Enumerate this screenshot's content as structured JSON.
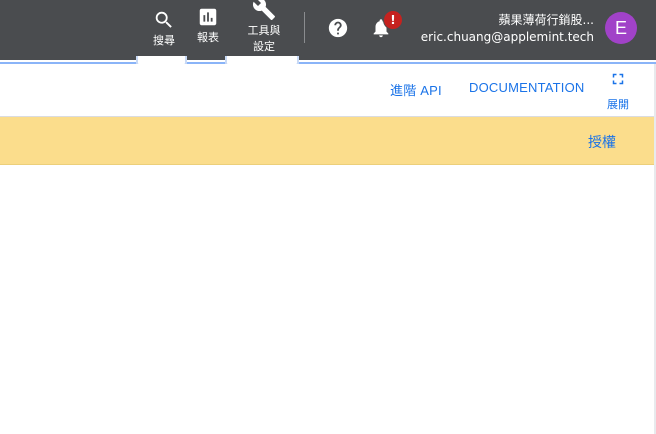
{
  "topbar": {
    "search_label": "搜尋",
    "reports_label": "報表",
    "tools_label_line1": "工具與",
    "tools_label_line2": "設定",
    "notification_badge": "!",
    "account_name": "蘋果薄荷行銷股...",
    "account_email": "eric.chuang@applemint.tech",
    "avatar_letter": "E",
    "avatar_color": "#a142c8",
    "icons": [
      "search-icon",
      "reports-icon",
      "wrench-icon",
      "help-icon",
      "bell-icon"
    ]
  },
  "actions": {
    "advanced_api": "進階 API",
    "documentation": "DOCUMENTATION",
    "expand_label": "展開"
  },
  "banner": {
    "authorize": "授權",
    "color": "#fbdd8c"
  }
}
